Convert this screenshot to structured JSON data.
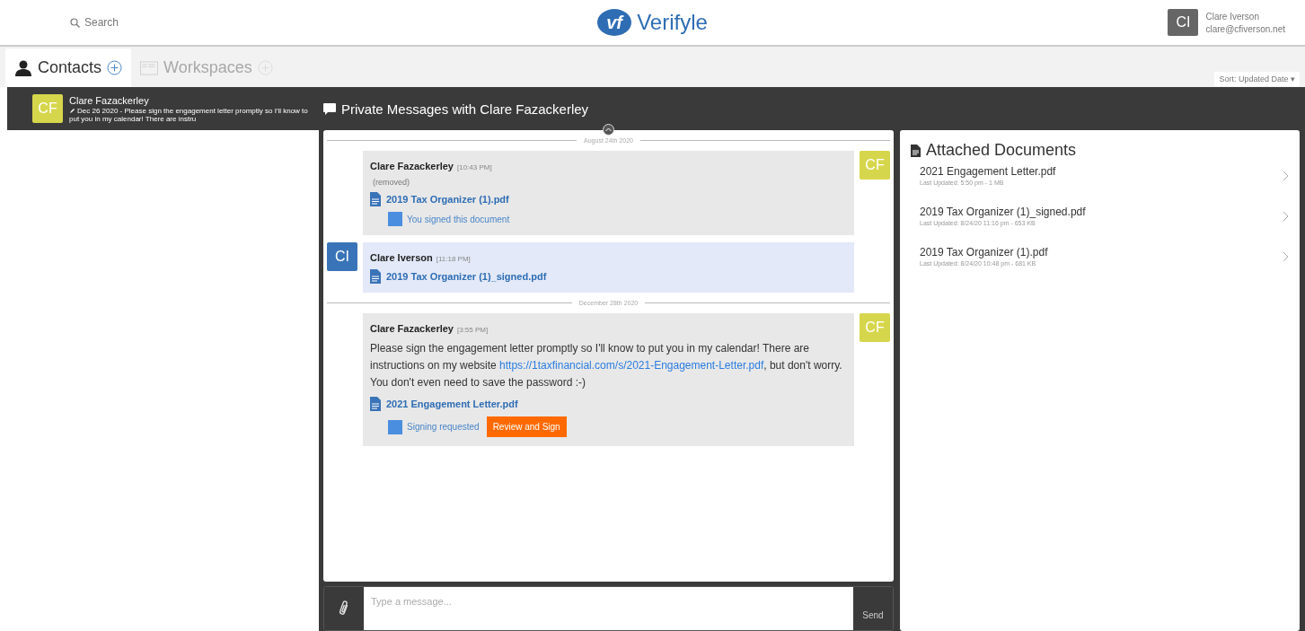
{
  "header": {
    "search": {
      "placeholder": "Search"
    },
    "logo": {
      "mark": "vf",
      "name": "Verifyle"
    },
    "user": {
      "initials": "CI",
      "name": "Clare Iverson",
      "email": "clare@cfiverson.net"
    }
  },
  "tabs": [
    {
      "label": "Contacts",
      "kind": "contacts",
      "selected": true
    },
    {
      "label": "Workspaces",
      "kind": "workspaces",
      "selected": false
    }
  ],
  "sort": {
    "label": "Sort: Updated Date",
    "caret": "▾"
  },
  "contacts": [
    {
      "initials": "CF",
      "color": "#d6d64c",
      "name": "Clare Fazackerley",
      "preview": "Dec 26 2020 - Please sign the engagement letter promptly so I'll know to put you in my calendar! There are instru",
      "selected": true
    }
  ],
  "conversation": {
    "title": "Private Messages with Clare Fazackerley",
    "items": [
      {
        "kind": "divider",
        "label": "August 24th 2020"
      },
      {
        "kind": "incoming",
        "initials": "CF",
        "color": "#d6d64c",
        "author": "Clare Fazackerley",
        "time": "[10:43 PM]",
        "note": "(removed)",
        "attachments": [
          {
            "name": "2019 Tax Organizer (1).pdf",
            "status": "You signed this document"
          }
        ]
      },
      {
        "kind": "outgoing",
        "initials": "CI",
        "color": "#3a74b8",
        "author": "Clare Iverson",
        "time": "[11:18 PM]",
        "attachments": [
          {
            "name": "2019 Tax Organizer (1)_signed.pdf"
          }
        ]
      },
      {
        "kind": "divider",
        "label": "December 28th 2020"
      },
      {
        "kind": "incoming",
        "initials": "CF",
        "color": "#d6d64c",
        "author": "Clare Fazackerley",
        "time": "[3:55 PM]",
        "text": {
          "before": "Please sign the engagement letter promptly so I'll know to put you in my calendar!  There are instructions on my website ",
          "link": "https://1taxfinancial.com/s/2021-Engagement-Letter.pdf",
          "after": ", but don't worry.  You don't even need to save the password :-)"
        },
        "attachments": [
          {
            "name": "2021 Engagement Letter.pdf",
            "status": "Signing requested",
            "action": "Review and Sign"
          }
        ]
      }
    ]
  },
  "composer": {
    "placeholder": "Type a message...",
    "send": "Send"
  },
  "documents": {
    "title": "Attached Documents",
    "items": [
      {
        "name": "2021 Engagement Letter.pdf",
        "meta": "Last Updated: 5:50 pm - 1 MB"
      },
      {
        "name": "2019 Tax Organizer (1)_signed.pdf",
        "meta": "Last Updated: 8/24/20 11:16 pm - 653 KB"
      },
      {
        "name": "2019 Tax Organizer (1).pdf",
        "meta": "Last Updated: 8/24/20 10:48 pm - 681 KB"
      }
    ]
  }
}
